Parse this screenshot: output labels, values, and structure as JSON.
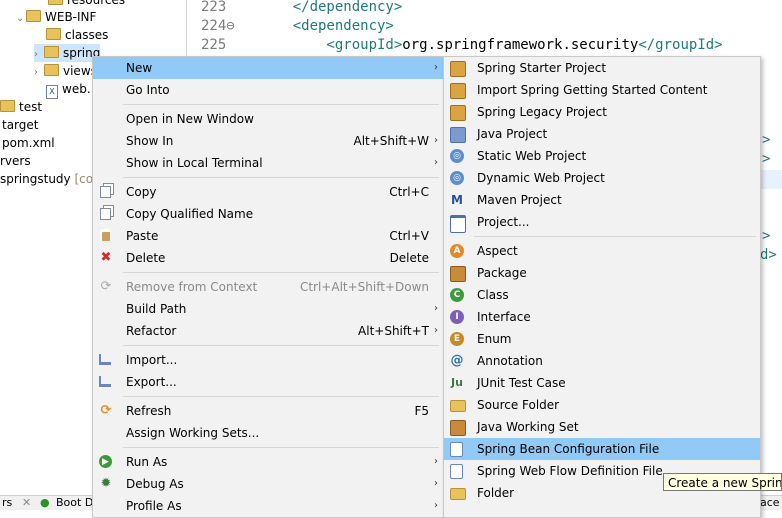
{
  "explorer": {
    "items": [
      {
        "label": "resources",
        "kind": "folder"
      },
      {
        "label": "WEB-INF",
        "kind": "folder"
      },
      {
        "label": "classes",
        "kind": "folder"
      },
      {
        "label": "spring",
        "kind": "folder"
      },
      {
        "label": "views",
        "kind": "folder"
      },
      {
        "label": "web.",
        "kind": "xml"
      },
      {
        "label": "test",
        "kind": "folder"
      },
      {
        "label": "target",
        "kind": "folder"
      },
      {
        "label": "pom.xml",
        "kind": "xml"
      },
      {
        "label": "rvers",
        "kind": "folder"
      },
      {
        "label": "springstudy",
        "kind": "project",
        "suffix": "[code"
      }
    ]
  },
  "editor": {
    "lines": [
      {
        "num": "223",
        "tag_open": "</dependency>",
        "text": "",
        "tag_close": ""
      },
      {
        "num": "224⊖",
        "tag_open": "<dependency>",
        "text": "",
        "tag_close": ""
      },
      {
        "num": "225",
        "tag_open": "    <groupId>",
        "text": "org.springframework.security",
        "tag_close": "</groupId>"
      }
    ],
    "partial": [
      ">",
      ">",
      ">",
      "d>"
    ]
  },
  "bottom": {
    "tab1": "rs",
    "tab2": "Boot D",
    "tab3": "ace"
  },
  "context_menu": {
    "items": [
      {
        "label": "New",
        "shortcut": "",
        "submenu": true,
        "icon": "",
        "active": true
      },
      {
        "label": "Go Into",
        "shortcut": "",
        "submenu": false,
        "icon": ""
      },
      {
        "label": "Open in New Window",
        "shortcut": "",
        "submenu": false,
        "icon": ""
      },
      {
        "label": "Show In",
        "shortcut": "Alt+Shift+W",
        "submenu": true,
        "icon": ""
      },
      {
        "label": "Show in Local Terminal",
        "shortcut": "",
        "submenu": true,
        "icon": ""
      },
      {
        "label": "Copy",
        "shortcut": "Ctrl+C",
        "submenu": false,
        "icon": "copy-icon"
      },
      {
        "label": "Copy Qualified Name",
        "shortcut": "",
        "submenu": false,
        "icon": "copy-qualified-icon"
      },
      {
        "label": "Paste",
        "shortcut": "Ctrl+V",
        "submenu": false,
        "icon": "paste-icon"
      },
      {
        "label": "Delete",
        "shortcut": "Delete",
        "submenu": false,
        "icon": "delete-icon"
      },
      {
        "label": "Remove from Context",
        "shortcut": "Ctrl+Alt+Shift+Down",
        "submenu": false,
        "icon": "remove-context-icon",
        "disabled": true
      },
      {
        "label": "Build Path",
        "shortcut": "",
        "submenu": true,
        "icon": ""
      },
      {
        "label": "Refactor",
        "shortcut": "Alt+Shift+T",
        "submenu": true,
        "icon": ""
      },
      {
        "label": "Import...",
        "shortcut": "",
        "submenu": false,
        "icon": "import-icon"
      },
      {
        "label": "Export...",
        "shortcut": "",
        "submenu": false,
        "icon": "export-icon"
      },
      {
        "label": "Refresh",
        "shortcut": "F5",
        "submenu": false,
        "icon": "refresh-icon"
      },
      {
        "label": "Assign Working Sets...",
        "shortcut": "",
        "submenu": false,
        "icon": ""
      },
      {
        "label": "Run As",
        "shortcut": "",
        "submenu": true,
        "icon": "run-icon"
      },
      {
        "label": "Debug As",
        "shortcut": "",
        "submenu": true,
        "icon": "debug-icon"
      },
      {
        "label": "Profile As",
        "shortcut": "",
        "submenu": true,
        "icon": ""
      }
    ]
  },
  "submenu": {
    "items": [
      {
        "label": "Spring Starter Project",
        "icon": "spring-project-icon"
      },
      {
        "label": "Import Spring Getting Started Content",
        "icon": "spring-import-icon"
      },
      {
        "label": "Spring Legacy Project",
        "icon": "spring-legacy-icon"
      },
      {
        "label": "Java Project",
        "icon": "java-project-icon"
      },
      {
        "label": "Static Web Project",
        "icon": "static-web-icon"
      },
      {
        "label": "Dynamic Web Project",
        "icon": "dynamic-web-icon"
      },
      {
        "label": "Maven Project",
        "icon": "maven-icon"
      },
      {
        "label": "Project...",
        "icon": "project-icon"
      },
      {
        "label": "Aspect",
        "icon": "aspect-icon"
      },
      {
        "label": "Package",
        "icon": "package-icon"
      },
      {
        "label": "Class",
        "icon": "class-icon"
      },
      {
        "label": "Interface",
        "icon": "interface-icon"
      },
      {
        "label": "Enum",
        "icon": "enum-icon"
      },
      {
        "label": "Annotation",
        "icon": "annotation-icon"
      },
      {
        "label": "JUnit Test Case",
        "icon": "junit-icon"
      },
      {
        "label": "Source Folder",
        "icon": "source-folder-icon"
      },
      {
        "label": "Java Working Set",
        "icon": "working-set-icon"
      },
      {
        "label": "Spring Bean Configuration File",
        "icon": "spring-bean-icon",
        "active": true
      },
      {
        "label": "Spring Web Flow Definition File",
        "icon": "web-flow-icon"
      },
      {
        "label": "Folder",
        "icon": "folder-icon"
      }
    ]
  },
  "tooltip": {
    "text": "Create a new Spring"
  },
  "colors": {
    "highlight": "#91c9f7",
    "menu_bg": "#f2f2f2",
    "xml_tag": "#1f7a7a"
  }
}
